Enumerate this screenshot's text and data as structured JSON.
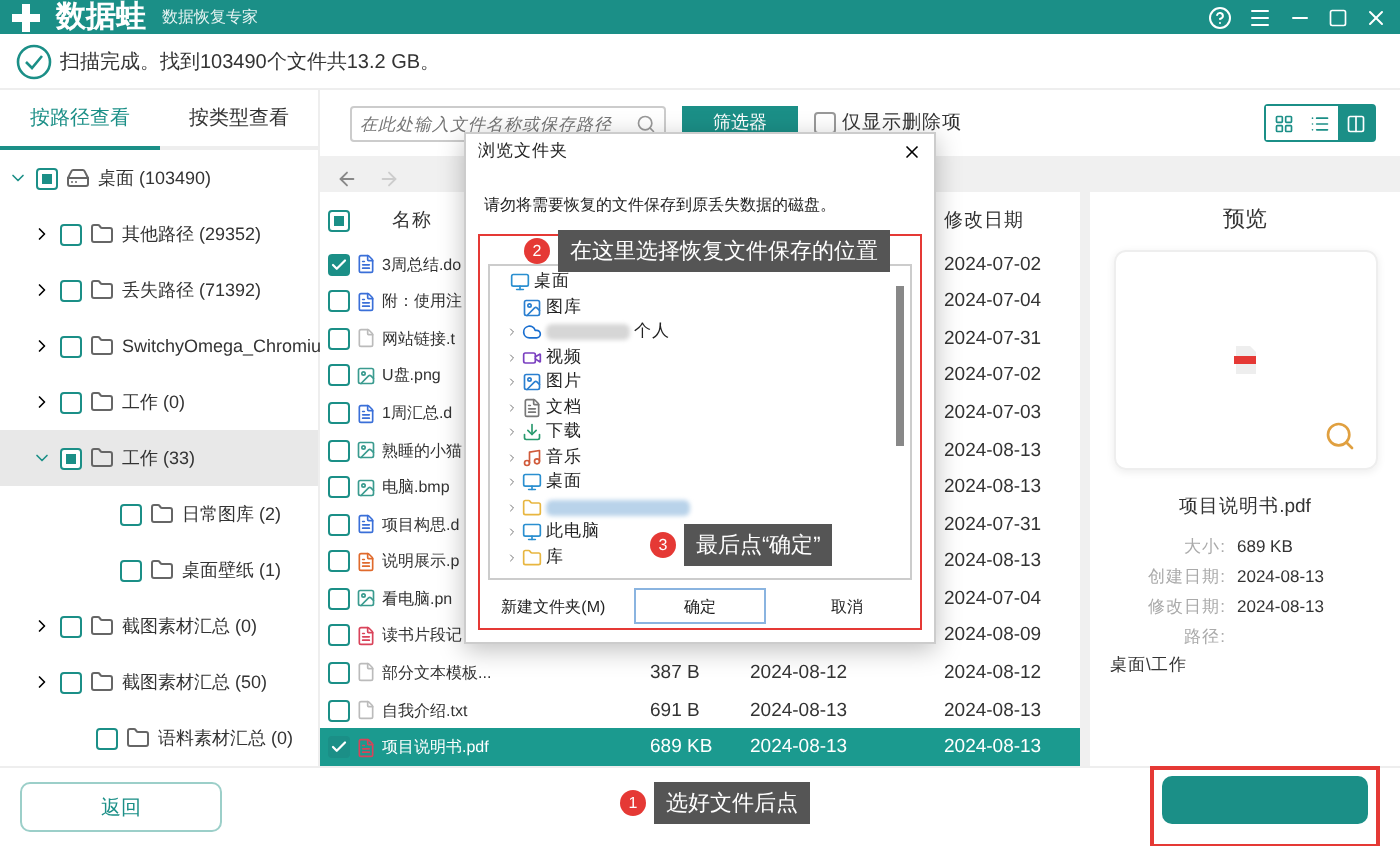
{
  "app": {
    "logo": "数据蛙",
    "subtitle": "数据恢复专家"
  },
  "status": "扫描完成。找到103490个文件共13.2 GB。",
  "sidebar": {
    "tabs": [
      {
        "label": "按路径查看",
        "selected": true
      },
      {
        "label": "按类型查看",
        "selected": false
      }
    ],
    "tree": [
      {
        "label": "桌面 (103490)",
        "kind": "drive",
        "expanded": true,
        "checked": false,
        "partial": true,
        "selected": false,
        "children": [
          {
            "label": "其他路径 (29352)",
            "kind": "folder",
            "expanded": false,
            "checked": false,
            "partial": false,
            "selected": false
          },
          {
            "label": "丢失路径 (71392)",
            "kind": "folder",
            "expanded": false,
            "checked": false,
            "partial": false,
            "selected": false
          },
          {
            "label": "SwitchyOmega_Chromiu",
            "kind": "folder",
            "expanded": false,
            "checked": false,
            "partial": false,
            "selected": false
          },
          {
            "label": "工作 (0)",
            "kind": "folder",
            "expanded": false,
            "checked": false,
            "partial": false,
            "selected": false
          },
          {
            "label": "工作 (33)",
            "kind": "folder",
            "expanded": true,
            "checked": false,
            "partial": true,
            "selected": true,
            "children": [
              {
                "label": "日常图库 (2)",
                "kind": "folder",
                "checked": false,
                "partial": false,
                "selected": false
              },
              {
                "label": "桌面壁纸 (1)",
                "kind": "folder",
                "checked": false,
                "partial": false,
                "selected": false
              }
            ]
          },
          {
            "label": "截图素材汇总 (0)",
            "kind": "folder",
            "expanded": false,
            "checked": false,
            "partial": false,
            "selected": false
          },
          {
            "label": "截图素材汇总 (50)",
            "kind": "folder",
            "expanded": false,
            "checked": false,
            "partial": false,
            "selected": false
          },
          {
            "label": "语料素材汇总 (0)",
            "kind": "folder",
            "checked": false,
            "partial": false,
            "selected": false
          }
        ]
      }
    ]
  },
  "toolbar": {
    "search": {
      "placeholder": "在此处输入文件名称或保存路径"
    },
    "filter_button": "筛选器",
    "deleted_only": {
      "label": "仅显示删除项",
      "checked": false
    },
    "view_modes": [
      {
        "kind": "grid",
        "selected": false
      },
      {
        "kind": "list",
        "selected": false
      },
      {
        "kind": "detail",
        "selected": true
      }
    ]
  },
  "file_list": {
    "header_partial": true,
    "columns": [
      {
        "label": "名称"
      },
      {
        "label": "修改日期"
      }
    ],
    "rows": [
      {
        "name": "3周总结.do",
        "kind": "doc",
        "modified": "2024-07-02",
        "checked": true,
        "selected": false
      },
      {
        "name": "附：使用注",
        "kind": "doc",
        "modified": "2024-07-04",
        "checked": false,
        "selected": false
      },
      {
        "name": "网站链接.t",
        "kind": "text",
        "modified": "2024-07-31",
        "checked": false,
        "selected": false
      },
      {
        "name": "U盘.png",
        "kind": "image",
        "modified": "2024-07-02",
        "checked": false,
        "selected": false
      },
      {
        "name": "1周汇总.d",
        "kind": "doc",
        "modified": "2024-07-03",
        "checked": false,
        "selected": false
      },
      {
        "name": "熟睡的小猫",
        "kind": "image",
        "modified": "2024-08-13",
        "checked": false,
        "selected": false
      },
      {
        "name": "电脑.bmp",
        "kind": "image",
        "modified": "2024-08-13",
        "checked": false,
        "selected": false
      },
      {
        "name": "项目构思.d",
        "kind": "doc",
        "modified": "2024-07-31",
        "checked": false,
        "selected": false
      },
      {
        "name": "说明展示.p",
        "kind": "ppt",
        "modified": "2024-08-13",
        "checked": false,
        "selected": false
      },
      {
        "name": "看电脑.pn",
        "kind": "image",
        "modified": "2024-07-04",
        "checked": false,
        "selected": false
      },
      {
        "name": "读书片段记",
        "kind": "pdf",
        "modified": "2024-08-09",
        "checked": false,
        "selected": false
      },
      {
        "name": "部分文本模板...",
        "kind": "text",
        "size": "387  B",
        "created": "2024-08-12",
        "modified": "2024-08-12",
        "checked": false,
        "selected": false
      },
      {
        "name": "自我介绍.txt",
        "kind": "text",
        "size": "691  B",
        "created": "2024-08-13",
        "modified": "2024-08-13",
        "checked": false,
        "selected": false
      },
      {
        "name": "项目说明书.pdf",
        "kind": "pdf",
        "size": "689 KB",
        "created": "2024-08-13",
        "modified": "2024-08-13",
        "checked": true,
        "selected": true
      }
    ]
  },
  "preview": {
    "title": "预览",
    "file_name": "项目说明书.pdf",
    "details": [
      {
        "label": "大小:",
        "value": "689 KB"
      },
      {
        "label": "创建日期:",
        "value": "2024-08-13"
      },
      {
        "label": "修改日期:",
        "value": "2024-08-13"
      },
      {
        "label": "路径:"
      }
    ],
    "path": "桌面\\工作"
  },
  "dialog": {
    "title": "浏览文件夹",
    "message": "请勿将需要恢复的文件保存到原丢失数据的磁盘。",
    "tree": [
      {
        "label": "桌面",
        "kind": "desktop",
        "children": [
          {
            "label": "图库",
            "kind": "gallery"
          },
          {
            "label": "个人",
            "kind": "cloud",
            "expanded": false,
            "redacted": true
          },
          {
            "label": "视频",
            "kind": "video",
            "expanded": false
          },
          {
            "label": "图片",
            "kind": "gallery",
            "expanded": false
          },
          {
            "label": "文档",
            "kind": "document",
            "expanded": false
          },
          {
            "label": "下载",
            "kind": "download",
            "expanded": false
          },
          {
            "label": "音乐",
            "kind": "music",
            "expanded": false
          },
          {
            "label": "桌面",
            "kind": "desktop",
            "expanded": false
          },
          {
            "kind": "folder",
            "expanded": false,
            "redacted": true,
            "selected": true
          },
          {
            "label": "此电脑",
            "kind": "computer",
            "expanded": false
          },
          {
            "label": "库",
            "kind": "folder",
            "expanded": false
          }
        ]
      }
    ],
    "buttons": [
      {
        "label": "新建文件夹(M)",
        "default": false
      },
      {
        "label": "确定",
        "default": true
      },
      {
        "label": "取消",
        "default": false
      }
    ]
  },
  "annotations": [
    {
      "number": "2",
      "text": "在这里选择恢复文件保存的位置"
    },
    {
      "number": "3",
      "text": "最后点“确定”"
    },
    {
      "number": "1",
      "text": "选好文件后点"
    }
  ],
  "bottom": {
    "back_button": "返回",
    "recover_button": {
      "highlighted": true
    }
  }
}
